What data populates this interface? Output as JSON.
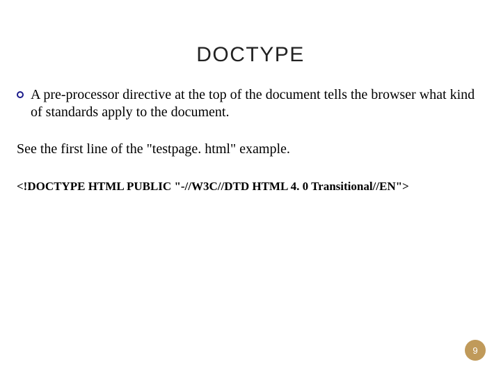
{
  "title": "DOCTYPE",
  "bullet": "A pre-processor directive at the top of the document tells the browser what kind of standards apply to the document.",
  "see_line": "See the first line of the \"testpage. html\" example.",
  "doctype_code": "<!DOCTYPE HTML PUBLIC \"-//W3C//DTD HTML 4. 0 Transitional//EN\">",
  "page_number": "9"
}
